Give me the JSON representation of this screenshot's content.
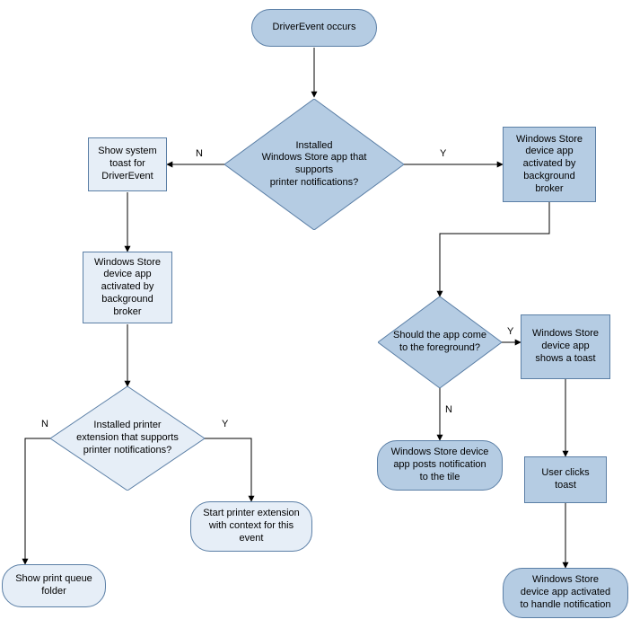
{
  "nodes": {
    "start": "DriverEvent occurs",
    "d_installed_app": "Installed\nWindows Store app that\nsupports\nprinter notifications?",
    "show_toast_driver": "Show system\ntoast for\nDriverEvent",
    "app_activated_left": "Windows Store\ndevice app\nactivated by\nbackground\nbroker",
    "app_activated_right": "Windows Store\ndevice app\nactivated by\nbackground\nbroker",
    "d_foreground": "Should the app come\nto the foreground?",
    "shows_toast": "Windows Store\ndevice app\nshows a toast",
    "posts_tile": "Windows Store device\napp posts notification\nto the tile",
    "user_clicks": "User clicks\ntoast",
    "app_handle_notif": "Windows Store\ndevice app activated\nto handle notification",
    "d_printer_ext": "Installed printer\nextension that supports\nprinter notifications?",
    "start_ext": "Start printer extension\nwith context for this\nevent",
    "show_queue": "Show print queue\nfolder"
  },
  "labels": {
    "N": "N",
    "Y": "Y"
  }
}
